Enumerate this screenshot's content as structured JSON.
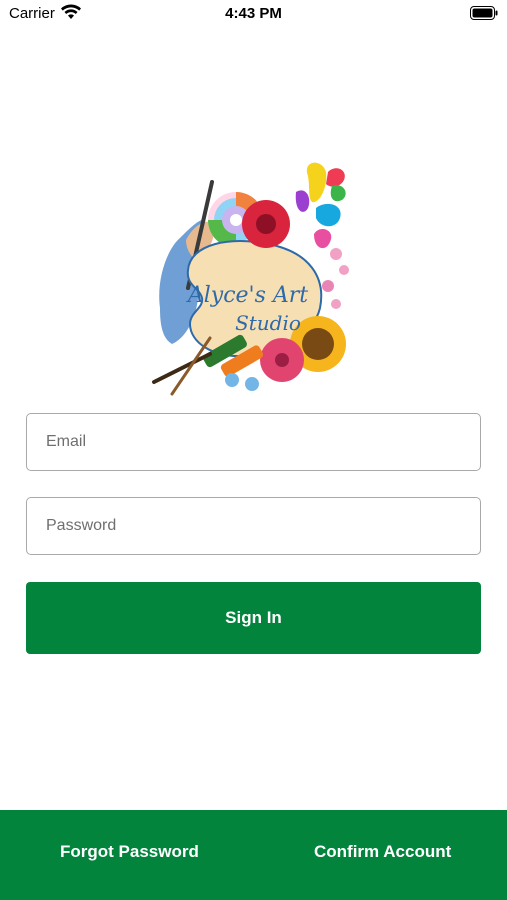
{
  "status_bar": {
    "carrier": "Carrier",
    "time": "4:43 PM"
  },
  "logo": {
    "text_line1": "Alyce's Art",
    "text_line2": "Studio"
  },
  "form": {
    "email_placeholder": "Email",
    "password_placeholder": "Password",
    "signin_label": "Sign In"
  },
  "footer": {
    "forgot_label": "Forgot Password",
    "confirm_label": "Confirm Account"
  },
  "colors": {
    "primary_green": "#03843d",
    "field_border": "#a9a9a9"
  }
}
